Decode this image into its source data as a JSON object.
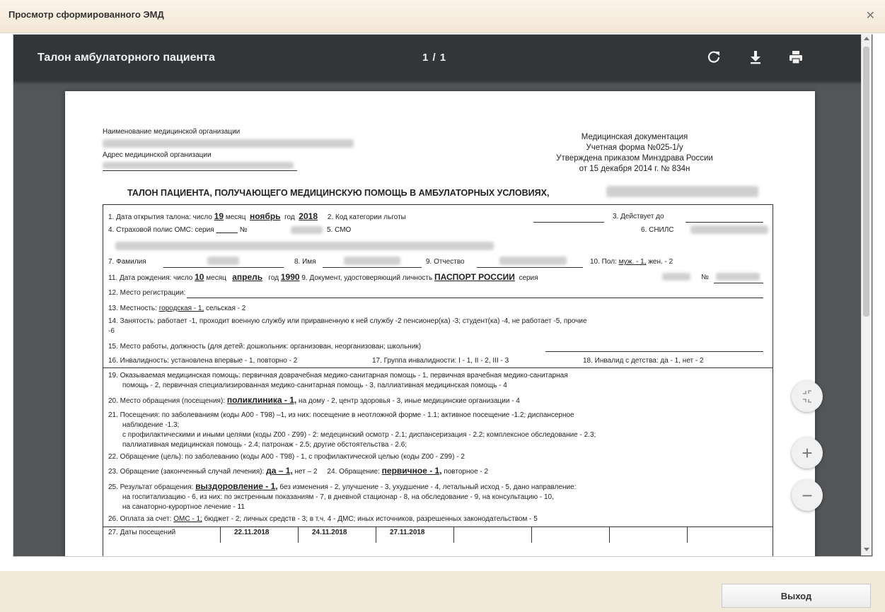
{
  "window": {
    "title": "Просмотр сформированного ЭМД",
    "close_glyph": "✕"
  },
  "viewer": {
    "doc_title": "Талон амбулаторного пациента",
    "page_counter": "1 / 1",
    "icons": [
      "rotate-icon",
      "download-icon",
      "print-icon"
    ]
  },
  "document": {
    "org_name_label": "Наименование медицинской организации",
    "org_address_label": "Адрес медицинской организации",
    "header_right": [
      "Медицинская документация",
      "Учетная форма №025-1/у",
      "Утверждена приказом Минздрава России",
      "от 15 декабря 2014 г. № 834н"
    ],
    "heading": "ТАЛОН ПАЦИЕНТА, ПОЛУЧАЮЩЕГО МЕДИЦИНСКУЮ ПОМОЩЬ В АМБУЛАТОРНЫХ УСЛОВИЯХ,",
    "line1": {
      "a": "1. Дата открытия талона: число",
      "day": "19",
      "b": "месяц",
      "month": "ноябрь",
      "c": "год",
      "year": "2018",
      "d": "2. Код категории льготы",
      "e": "3. Действует до"
    },
    "line2": {
      "a": "4. Страховой полис ОМС: серия",
      "b": "№",
      "c": "5. СМО",
      "d": "6. СНИЛС"
    },
    "line3": {
      "a": "7. Фамилия",
      "b": "8. Имя",
      "c": "9. Отчество",
      "d": "10. Пол:",
      "sex_male": "муж. - 1,",
      "sex_female": "жен. - 2"
    },
    "line4": {
      "a": "11. Дата рождения: число",
      "day": "10",
      "b": "месяц",
      "month": "апрель",
      "c": "год",
      "year": "1990",
      "d": "9. Документ, удостоверяющий личность",
      "doc": "ПАСПОРТ РОССИИ",
      "e": "серия",
      "f": "№"
    },
    "line5": "12. Место регистрации:",
    "line6": {
      "a": "13. Местность:",
      "u": "городская - 1,",
      "b": "сельская - 2"
    },
    "line7": "14. Занятость: работает -1, проходит военную службу или приравненную к ней службу -2 пенсионер(ка) -3; студент(ка) -4, не работает -5, прочие",
    "line7b": "-6",
    "line8": "15. Место работы, должность (для детей: дошкольник: организован, неорганизован; школьник)",
    "line9": {
      "a": "16. Инвалидность: установлена впервые - 1, повторно - 2",
      "b": "17. Группа инвалидности: I - 1, II - 2, III - 3",
      "c": "18. Инвалид с детства: да - 1, нет - 2"
    },
    "line10": "19. Оказываемая медицинская помощь: первичная доврачебная медико-санитарная помощь - 1, первичная врачебная медико-санитарная",
    "line10b": "помощь - 2, первичная специализированная медико-санитарная помощь - 3, паллиативная медицинская помощь - 4",
    "line11": {
      "a": "20. Место обращения (посещения):",
      "v": "поликлиника - 1,",
      "b": "на дому - 2,  центр здоровья - 3, иные медицинские организации - 4"
    },
    "line12": "21. Посещения: по заболеваниям (коды А00 - Т98) –1,  из них: посещение в неотложной форме - 1.1; активное посещение -1.2;  диспансерное",
    "line12b": "наблюдение -1.3;",
    "line12c": "с профилактическими и иными целями (коды Z00 - Z99) - 2: медецинский осмотр - 2.1;  диспансеризация - 2.2;  комплексное обследование - 2.3;",
    "line12d": "паллиативная медицинская помощь - 2.4; патронаж - 2.5;  другие обстоятельства - 2.6;",
    "line13": "22. Обращение (цель): по заболеванию (коды А00 - Т98) - 1,  с профилактической целью (коды Z00 - Z99) - 2",
    "line14": {
      "a": "23. Обращение (законченный случай лечения):",
      "v1": "да – 1,",
      "b": "нет – 2",
      "c": "24. Обращение:",
      "v2": "первичное - 1,",
      "d": "повторное - 2"
    },
    "line15": {
      "a": "25. Результат обращения:",
      "v": "выздоровление - 1,",
      "b": "без изменения - 2, улучшение - 3, ухудшение - 4, летальный исход - 5, дано направление:"
    },
    "line15b": "на госпитализацию - 6, из них: по экстренным показаниям - 7, в дневной стационар - 8, на обследование - 9, на консультацию - 10,",
    "line15c": "на санаторно-курортное лечение - 11",
    "line16": {
      "a": "26. Оплата за счет:",
      "u": "ОМС - 1;",
      "b": "бюджет - 2; личных средств - 3; в т.ч. 4 - ДМС; иных источников, разрешенных законодательством - 5"
    },
    "table_row": [
      "27. Даты посещений",
      "22.11.2018",
      "24.11.2018",
      "27.11.2018"
    ]
  },
  "zoom": {
    "fit_icon": "compress-icon",
    "in": "+",
    "out": "−"
  },
  "footer": {
    "exit_label": "Выход"
  }
}
